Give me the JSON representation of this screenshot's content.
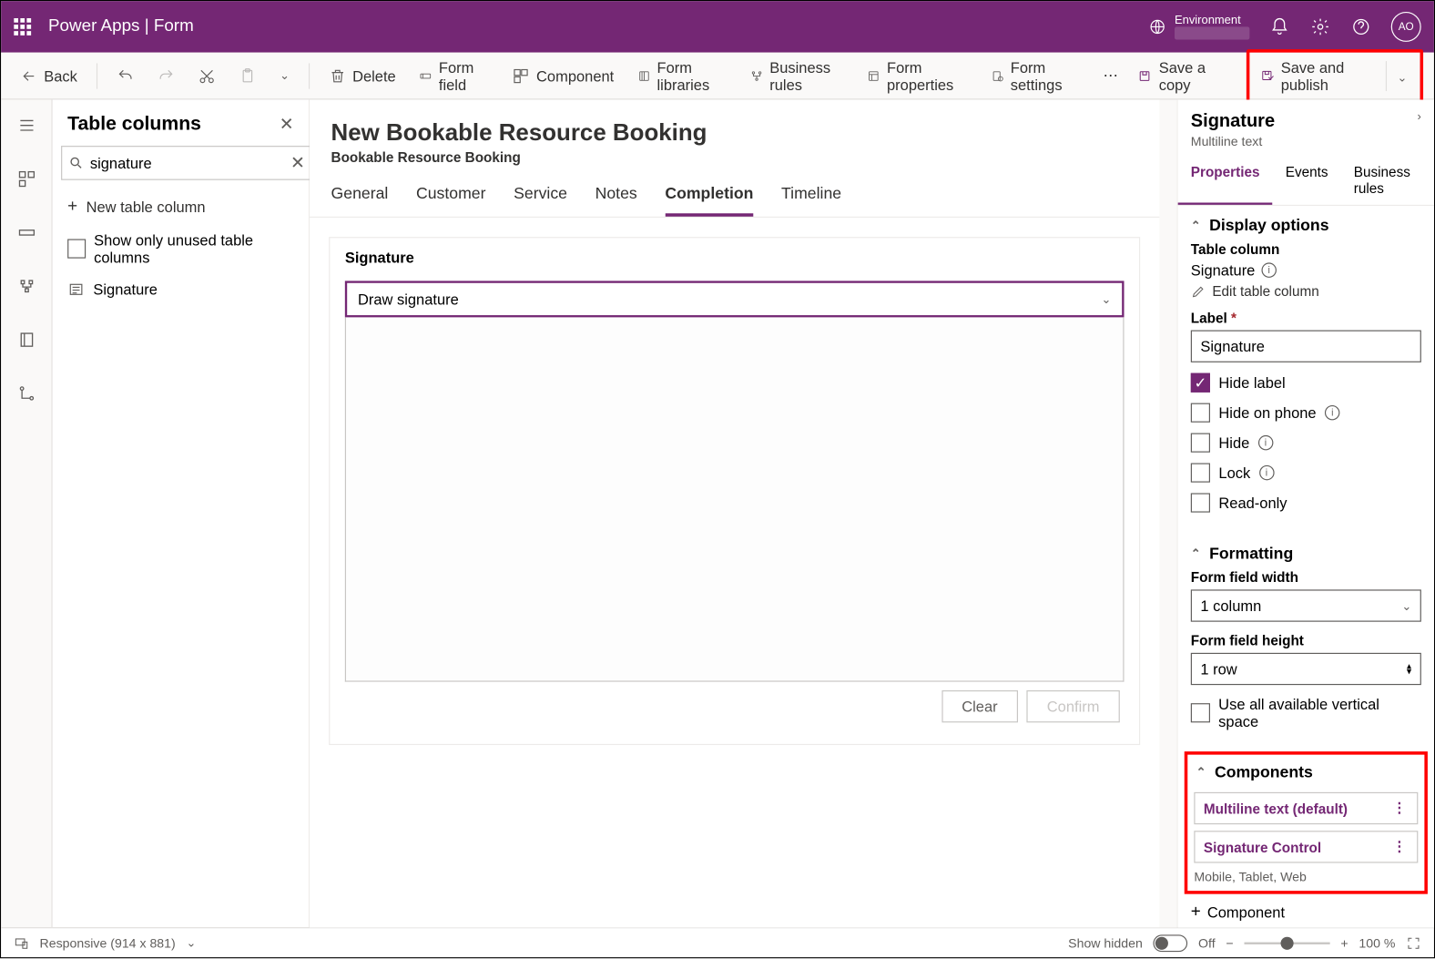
{
  "topbar": {
    "app": "Power Apps",
    "page": "Form",
    "title": "Power Apps | Form",
    "env_label": "Environment",
    "avatar": "AO"
  },
  "cmdbar": {
    "back": "Back",
    "delete": "Delete",
    "form_field": "Form field",
    "component": "Component",
    "form_libraries": "Form libraries",
    "business_rules": "Business rules",
    "form_properties": "Form properties",
    "form_settings": "Form settings",
    "save_copy": "Save a copy",
    "save_publish": "Save and publish"
  },
  "sidepanel": {
    "title": "Table columns",
    "search_value": "signature",
    "new_column": "New table column",
    "show_unused": "Show only unused table columns",
    "items": [
      "Signature"
    ]
  },
  "form": {
    "title": "New Bookable Resource Booking",
    "subtitle": "Bookable Resource Booking",
    "tabs": [
      "General",
      "Customer",
      "Service",
      "Notes",
      "Completion",
      "Timeline"
    ],
    "active_tab": "Completion",
    "section_label": "Signature",
    "draw_label": "Draw signature",
    "clear": "Clear",
    "confirm": "Confirm"
  },
  "rpanel": {
    "title": "Signature",
    "subtitle": "Multiline text",
    "tabs": [
      "Properties",
      "Events",
      "Business rules"
    ],
    "display_options": "Display options",
    "table_column": "Table column",
    "table_column_value": "Signature",
    "edit_table_column": "Edit table column",
    "label_label": "Label",
    "label_value": "Signature",
    "hide_label": "Hide label",
    "hide_on_phone": "Hide on phone",
    "hide": "Hide",
    "lock": "Lock",
    "read_only": "Read-only",
    "formatting": "Formatting",
    "field_width_label": "Form field width",
    "field_width_value": "1 column",
    "field_height_label": "Form field height",
    "field_height_value": "1 row",
    "use_all_space": "Use all available vertical space",
    "components": "Components",
    "comp_multiline": "Multiline text (default)",
    "comp_signature": "Signature Control",
    "comp_platforms": "Mobile, Tablet, Web",
    "add_component": "Component"
  },
  "footer": {
    "responsive": "Responsive (914 x 881)",
    "show_hidden": "Show hidden",
    "off": "Off",
    "zoom": "100 %"
  }
}
